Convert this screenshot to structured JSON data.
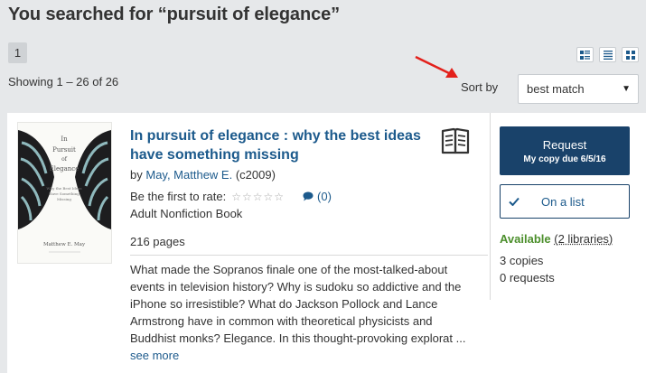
{
  "search": {
    "title": "You searched for “pursuit of elegance”",
    "page": "1",
    "showing": "Showing 1 – 26 of 26",
    "view_icons": [
      "list-view-icon",
      "compact-view-icon",
      "grid-view-icon"
    ],
    "sort_label": "Sort by",
    "sort_value": "best match"
  },
  "result": {
    "cover": {
      "lines": [
        "In",
        "Pursuit",
        "of",
        "Elegance"
      ],
      "subtitle": [
        "Why the Best Ideas",
        "Have Something",
        "Missing"
      ],
      "author": "Matthew E. May"
    },
    "title": "In pursuit of elegance : why the best ideas have something missing",
    "by_label": "by",
    "author": "May, Matthew E.",
    "year": "(c2009)",
    "rate_prompt": "Be the first to rate:",
    "comment_count": "(0)",
    "format": "Adult Nonfiction Book",
    "pages": "216 pages",
    "description": "What made the Sopranos finale one of the most-talked-about events in television history? Why is sudoku so addictive and the iPhone so irresistible? What do Jackson Pollock and Lance Armstrong have in common with theoretical physicists and Buddhist monks? Elegance. In this thought-provoking explorat ...",
    "see_more": "see more",
    "request_label": "Request",
    "request_sub": "My copy due 6/5/16",
    "list_label": "On a list",
    "availability_status": "Available",
    "availability_detail": "(2 libraries)",
    "copies": "3 copies",
    "requests": "0 requests",
    "format_icon": "book-icon"
  },
  "colors": {
    "link": "#1c5a8c",
    "button": "#19426a",
    "available": "#4c8f2c",
    "annotation_arrow": "#e3201b"
  }
}
